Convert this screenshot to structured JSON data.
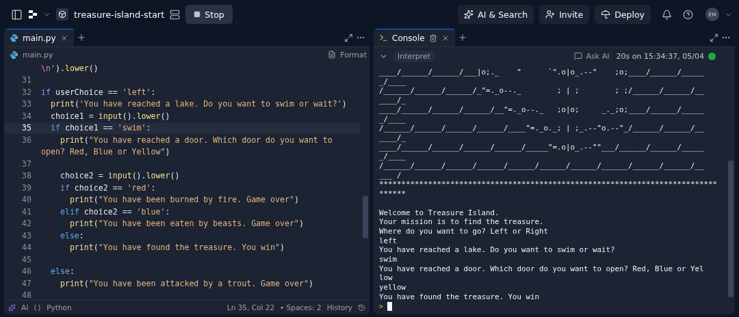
{
  "topbar": {
    "title": "treasure-island-start",
    "run_button": "Stop",
    "actions": [
      "AI & Search",
      "Invite",
      "Deploy"
    ],
    "avatar": "EM"
  },
  "editor": {
    "tabs": [
      {
        "label": "main.py",
        "selected": true
      }
    ],
    "breadcrumb": "main.py",
    "format": "Format",
    "rows": [
      {
        "tokens": [
          {
            "kind": "e",
            "text": "\\n"
          },
          {
            "kind": "s",
            "text": "'"
          },
          {
            "kind": "t",
            "text": ")."
          },
          {
            "kind": "f",
            "text": "lower"
          },
          {
            "kind": "t",
            "text": "()"
          }
        ]
      },
      {
        "number": "31",
        "active": false
      },
      {
        "number": "32",
        "active": false,
        "tokens": [
          {
            "kind": "k",
            "text": "if"
          },
          {
            "kind": "t",
            "text": " userChoice == "
          },
          {
            "kind": "s",
            "text": "'left'"
          },
          {
            "kind": "t",
            "text": ":"
          }
        ]
      },
      {
        "number": "33",
        "active": false,
        "tokens": [
          {
            "kind": "f",
            "text": "  print"
          },
          {
            "kind": "t",
            "text": "("
          },
          {
            "kind": "s",
            "text": "'You have reached a lake. Do you want to swim or wait?'"
          },
          {
            "kind": "t",
            "text": ")"
          }
        ]
      },
      {
        "number": "34",
        "active": false,
        "tokens": [
          {
            "kind": "t",
            "text": "  choice1 = "
          },
          {
            "kind": "f",
            "text": "input"
          },
          {
            "kind": "t",
            "text": "()."
          },
          {
            "kind": "f",
            "text": "lower"
          },
          {
            "kind": "t",
            "text": "()"
          }
        ]
      },
      {
        "number": "35",
        "active": true,
        "tokens": [
          {
            "kind": "k",
            "text": "  if"
          },
          {
            "kind": "t",
            "text": " choice1 == "
          },
          {
            "kind": "s",
            "text": "'swim'"
          },
          {
            "kind": "t",
            "text": ":"
          }
        ]
      },
      {
        "number": "36",
        "active": false,
        "tokens": [
          {
            "kind": "f",
            "text": "    print"
          },
          {
            "kind": "t",
            "text": "("
          },
          {
            "kind": "s",
            "text": "\"You have reached a door. Which door do you want to"
          }
        ]
      },
      {
        "tokens": [
          {
            "kind": "s",
            "text": "open? Red, Blue or Yellow\""
          },
          {
            "kind": "t",
            "text": ")"
          }
        ]
      },
      {
        "number": "37",
        "active": false
      },
      {
        "number": "38",
        "active": false,
        "tokens": [
          {
            "kind": "t",
            "text": "    choice2 = "
          },
          {
            "kind": "f",
            "text": "input"
          },
          {
            "kind": "t",
            "text": "()."
          },
          {
            "kind": "f",
            "text": "lower"
          },
          {
            "kind": "t",
            "text": "()"
          }
        ]
      },
      {
        "number": "39",
        "active": false,
        "tokens": [
          {
            "kind": "k",
            "text": "    if"
          },
          {
            "kind": "t",
            "text": " choice2 == "
          },
          {
            "kind": "s",
            "text": "'red'"
          },
          {
            "kind": "t",
            "text": ":"
          }
        ]
      },
      {
        "number": "40",
        "active": false,
        "tokens": [
          {
            "kind": "f",
            "text": "      print"
          },
          {
            "kind": "t",
            "text": "("
          },
          {
            "kind": "s",
            "text": "\"You have been burned by fire. Game over\""
          },
          {
            "kind": "t",
            "text": ")"
          }
        ]
      },
      {
        "number": "41",
        "active": false,
        "tokens": [
          {
            "kind": "k",
            "text": "    elif"
          },
          {
            "kind": "t",
            "text": " choice2 == "
          },
          {
            "kind": "s",
            "text": "'blue'"
          },
          {
            "kind": "t",
            "text": ":"
          }
        ]
      },
      {
        "number": "42",
        "active": false,
        "tokens": [
          {
            "kind": "f",
            "text": "      print"
          },
          {
            "kind": "t",
            "text": "("
          },
          {
            "kind": "s",
            "text": "\"You have been eaten by beasts. Game over\""
          },
          {
            "kind": "t",
            "text": ")"
          }
        ]
      },
      {
        "number": "43",
        "active": false,
        "tokens": [
          {
            "kind": "k",
            "text": "    else"
          },
          {
            "kind": "t",
            "text": ":"
          }
        ]
      },
      {
        "number": "44",
        "active": false,
        "tokens": [
          {
            "kind": "f",
            "text": "      print"
          },
          {
            "kind": "t",
            "text": "("
          },
          {
            "kind": "s",
            "text": "\"You have found the treasure. You win\""
          },
          {
            "kind": "t",
            "text": ")"
          }
        ]
      },
      {
        "number": "45",
        "active": false
      },
      {
        "number": "46",
        "active": false,
        "tokens": [
          {
            "kind": "k",
            "text": "  else"
          },
          {
            "kind": "t",
            "text": ":"
          }
        ]
      },
      {
        "number": "47",
        "active": false,
        "tokens": [
          {
            "kind": "f",
            "text": "    print"
          },
          {
            "kind": "t",
            "text": "("
          },
          {
            "kind": "s",
            "text": "\"You have been attacked by a trout. Game over\""
          },
          {
            "kind": "t",
            "text": ")"
          }
        ]
      },
      {
        "number": "48",
        "active": false
      }
    ],
    "status": {
      "ai": "AI",
      "language": "Python",
      "cursor": "Ln 35, Col 22",
      "spaces": "• Spaces: 2",
      "history": "History"
    }
  },
  "console": {
    "tabs": [
      {
        "label": "Console",
        "selected": true
      }
    ],
    "mode": "Interpret",
    "ask_ai": "Ask AI",
    "run_info": "20s on 15:34:37, 05/04",
    "output": "____/______/______/___|o;._    \"      `\".o|o_.--\"    ;o;____/______/_____\n_/____\n/______/______/______/_\"=._o--._        ; | ;        ; ;/______/______/__\n____/_\n____/______/______/______/__\"=._o--._   ;o|o;     _._;o;____/______/_____\n_/____\n/______/______/______/______/____\"=._o._; | ;_.--\"o.--\"_/______/______/__\n____/_\n____/______/______/______/______/_____\"=.o|o_.--\"\"___/______/______/_____\n_/____\n/______/______/______/______/______/______/______/______/______/______/__\n___ /\n****************************************************************************\n******\n\nWelcome to Treasure Island.\nYour mission is to find the treasure.\nWhere do you want to go? Left or Right\nleft\nYou have reached a lake. Do you want to swim or wait?\nswim\nYou have reached a door. Which door do you want to open? Red, Blue or Yel\nlow\nyellow\nYou have found the treasure. You win",
    "prompt": ">"
  }
}
